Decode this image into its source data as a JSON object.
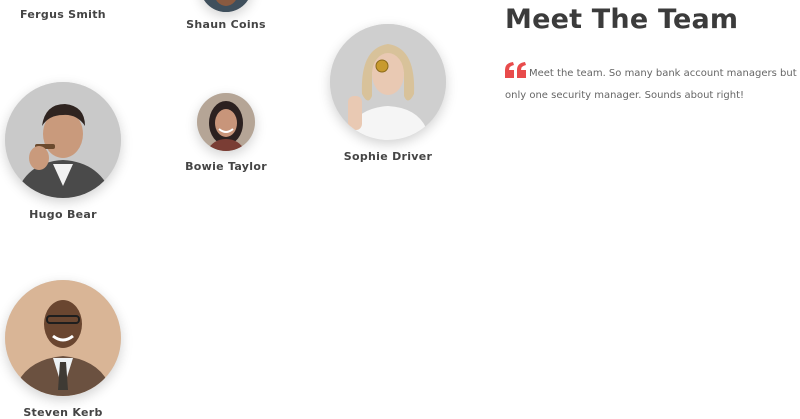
{
  "section": {
    "title": "Meet The Team",
    "quote": "Meet the team. So many bank account managers but only one security manager. Sounds about right!",
    "accent_color": "#e84b4b"
  },
  "team": [
    {
      "name": "Fergus Smith",
      "avatar": "photo-portrait"
    },
    {
      "name": "Shaun Coins",
      "avatar": "photo-portrait"
    },
    {
      "name": "Sophie Driver",
      "avatar": "photo-portrait"
    },
    {
      "name": "Hugo Bear",
      "avatar": "photo-portrait"
    },
    {
      "name": "Bowie Taylor",
      "avatar": "photo-portrait"
    },
    {
      "name": "Steven Kerb",
      "avatar": "photo-portrait"
    }
  ]
}
